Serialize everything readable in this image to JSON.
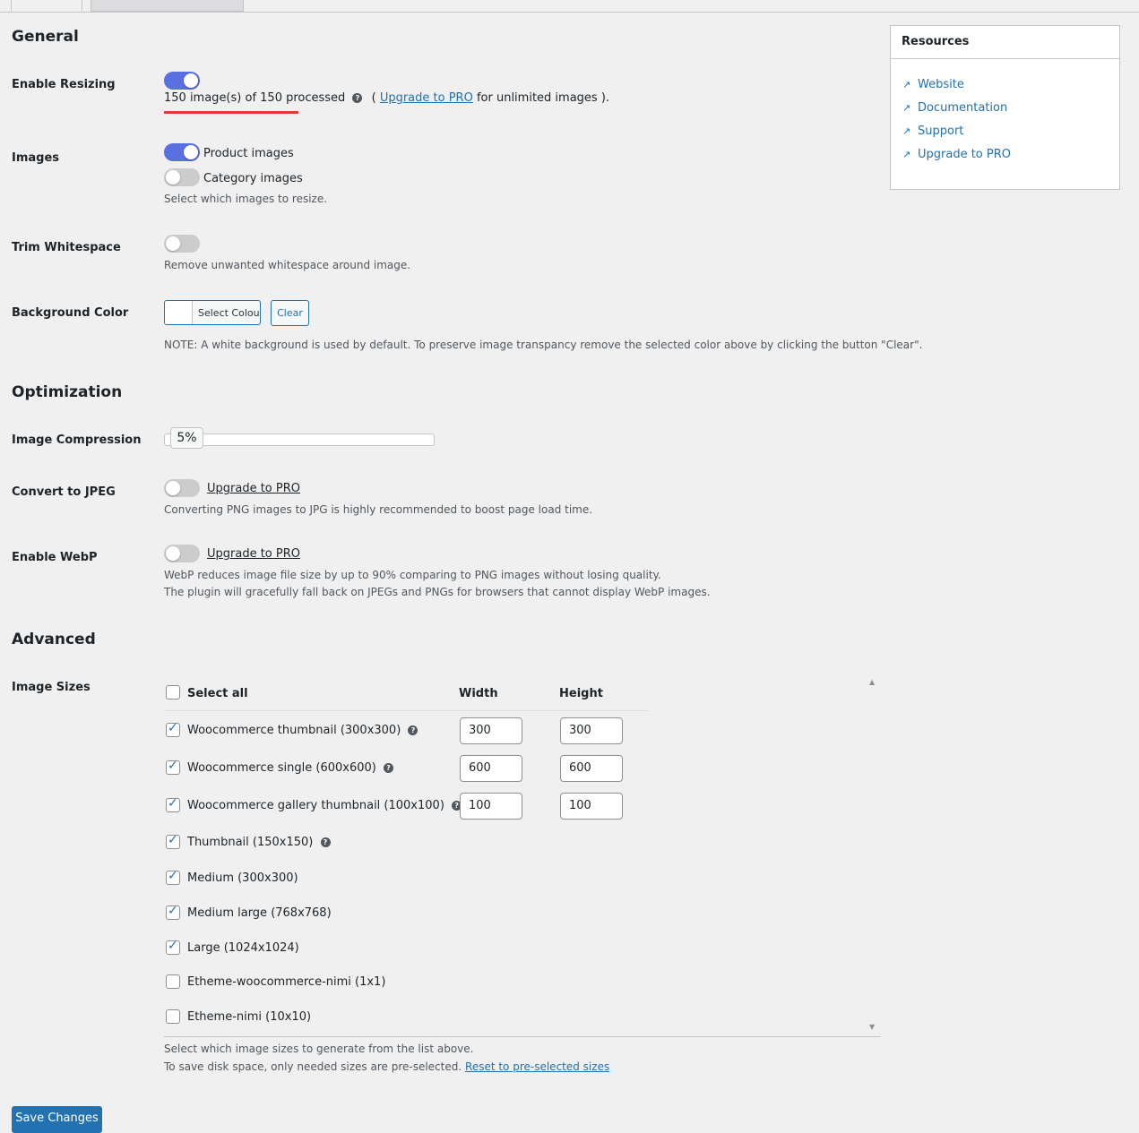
{
  "general": {
    "heading": "General",
    "enable_resizing": {
      "label": "Enable Resizing",
      "enabled": true,
      "status_text": "150 image(s) of 150 processed",
      "paren_open": "(",
      "upgrade_link": "Upgrade to PRO",
      "upgrade_suffix": "for unlimited images ).",
      "help_icon": "question-circle-icon"
    },
    "images": {
      "label": "Images",
      "options": [
        {
          "label": "Product images",
          "enabled": true
        },
        {
          "label": "Category images",
          "enabled": false
        }
      ],
      "description": "Select which images to resize."
    },
    "trim_whitespace": {
      "label": "Trim Whitespace",
      "enabled": false,
      "description": "Remove unwanted whitespace around image."
    },
    "background_color": {
      "label": "Background Color",
      "select_button": "Select Colour",
      "clear_button": "Clear",
      "note": "NOTE: A white background is used by default. To preserve image transpancy remove the selected color above by clicking the button \"Clear\".",
      "swatch_color": "#ffffff"
    }
  },
  "optimization": {
    "heading": "Optimization",
    "image_compression": {
      "label": "Image Compression",
      "value_text": "5%",
      "value": 5
    },
    "convert_jpeg": {
      "label": "Convert to JPEG",
      "enabled": false,
      "upgrade_link": "Upgrade to PRO",
      "description": "Converting PNG images to JPG is highly recommended to boost page load time."
    },
    "enable_webp": {
      "label": "Enable WebP",
      "enabled": false,
      "upgrade_link": "Upgrade to PRO",
      "description_1": "WebP reduces image file size by up to 90% comparing to PNG images without losing quality.",
      "description_2": "The plugin will gracefully fall back on JPEGs and PNGs for browsers that cannot display WebP images."
    }
  },
  "advanced": {
    "heading": "Advanced",
    "image_sizes": {
      "label": "Image Sizes",
      "select_all": "Select all",
      "col_width": "Width",
      "col_height": "Height",
      "rows": [
        {
          "name": "Woocommerce thumbnail (300x300)",
          "checked": true,
          "help": true,
          "width": "300",
          "height": "300"
        },
        {
          "name": "Woocommerce single (600x600)",
          "checked": true,
          "help": true,
          "width": "600",
          "height": "600"
        },
        {
          "name": "Woocommerce gallery thumbnail (100x100)",
          "checked": true,
          "help": true,
          "width": "100",
          "height": "100"
        },
        {
          "name": "Thumbnail (150x150)",
          "checked": true,
          "help": true
        },
        {
          "name": "Medium (300x300)",
          "checked": true,
          "help": false
        },
        {
          "name": "Medium large (768x768)",
          "checked": true,
          "help": false
        },
        {
          "name": "Large (1024x1024)",
          "checked": true,
          "help": false
        },
        {
          "name": "Etheme-woocommerce-nimi (1x1)",
          "checked": false,
          "help": false
        },
        {
          "name": "Etheme-nimi (10x10)",
          "checked": false,
          "help": false
        }
      ],
      "description_1": "Select which image sizes to generate from the list above.",
      "description_2": "To save disk space, only needed sizes are pre-selected.",
      "reset_link": "Reset to pre-selected sizes"
    }
  },
  "resources": {
    "heading": "Resources",
    "links": [
      "Website",
      "Documentation",
      "Support",
      "Upgrade to PRO"
    ],
    "link_icon": "external-link-icon"
  },
  "save_button": "Save Changes",
  "colors": {
    "accent": "#2271b1",
    "toggle_on": "#5a6fe0",
    "underline": "#e53935"
  }
}
